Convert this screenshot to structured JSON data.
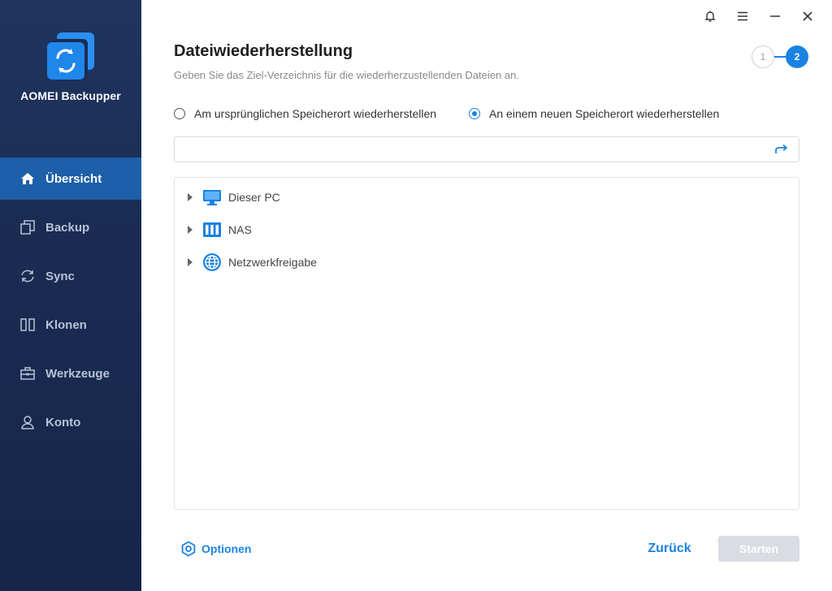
{
  "app": {
    "name": "AOMEI Backupper"
  },
  "sidebar": {
    "items": [
      {
        "label": "Übersicht",
        "icon": "home-icon",
        "active": true
      },
      {
        "label": "Backup",
        "icon": "backup-icon",
        "active": false
      },
      {
        "label": "Sync",
        "icon": "sync-icon",
        "active": false
      },
      {
        "label": "Klonen",
        "icon": "clone-icon",
        "active": false
      },
      {
        "label": "Werkzeuge",
        "icon": "toolbox-icon",
        "active": false
      },
      {
        "label": "Konto",
        "icon": "user-icon",
        "active": false
      }
    ]
  },
  "window": {
    "controls": [
      "bell-icon",
      "menu-icon",
      "minimize-icon",
      "close-icon"
    ]
  },
  "main": {
    "title": "Dateiwiederherstellung",
    "subtitle": "Geben Sie das Ziel-Verzeichnis für die wiederherzustellenden Dateien an.",
    "steps": {
      "step1": "1",
      "step2": "2",
      "current": 2
    },
    "restore_options": [
      {
        "label": "Am ursprünglichen Speicherort wiederherstellen",
        "checked": false
      },
      {
        "label": "An einem neuen Speicherort wiederherstellen",
        "checked": true
      }
    ],
    "path_input": {
      "value": "",
      "placeholder": ""
    },
    "tree": [
      {
        "label": "Dieser PC",
        "icon": "computer-icon"
      },
      {
        "label": "NAS",
        "icon": "nas-icon"
      },
      {
        "label": "Netzwerkfreigabe",
        "icon": "network-share-icon"
      }
    ]
  },
  "footer": {
    "options_label": "Optionen",
    "back_label": "Zurück",
    "start_label": "Starten"
  },
  "colors": {
    "sidebar_bg": "#1a2c52",
    "active_nav": "#1d5fa8",
    "accent": "#1a82e2",
    "disabled_button": "#d9dde3"
  }
}
